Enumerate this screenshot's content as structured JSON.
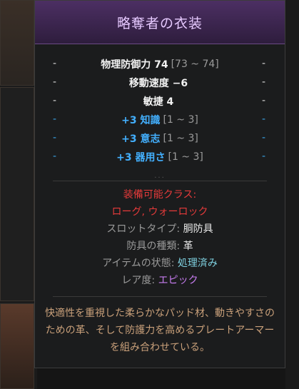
{
  "item": {
    "name": "略奪者の衣装",
    "stats": [
      {
        "dash": "-",
        "main": "物理防御力 74",
        "range": "[73 ~ 74]",
        "type": "base"
      },
      {
        "dash": "-",
        "main": "移動速度 −6",
        "range": "",
        "type": "base"
      },
      {
        "dash": "-",
        "main": "敏捷 4",
        "range": "",
        "type": "base"
      },
      {
        "dash": "-",
        "main": "+3 知識",
        "range": "[1 ~ 3]",
        "type": "bonus"
      },
      {
        "dash": "-",
        "main": "+3 意志",
        "range": "[1 ~ 3]",
        "type": "bonus"
      },
      {
        "dash": "-",
        "main": "+3 器用さ",
        "range": "[1 ~ 3]",
        "type": "bonus"
      }
    ],
    "divider_dots": "···",
    "requirements": {
      "class_label": "装備可能クラス:",
      "classes": "ローグ, ウォーロック",
      "slot_label": "スロットタイプ:",
      "slot_value": "胴防具",
      "armor_label": "防具の種類:",
      "armor_value": "革",
      "state_label": "アイテムの状態:",
      "state_value": "処理済み",
      "rarity_label": "レア度:",
      "rarity_value": "エピック"
    },
    "flavor_text": "快適性を重視した柔らかなパッド材、動きやすさのための革、そして防護力を高めるプレートアーマーを組み合わせている。"
  },
  "colors": {
    "title": "#e6c9ff",
    "bonus_stat": "#43b0ff",
    "class_req": "#e53a3a",
    "state": "#7fd1e0",
    "rarity": "#c77df0",
    "flavor": "#c9a07a"
  }
}
